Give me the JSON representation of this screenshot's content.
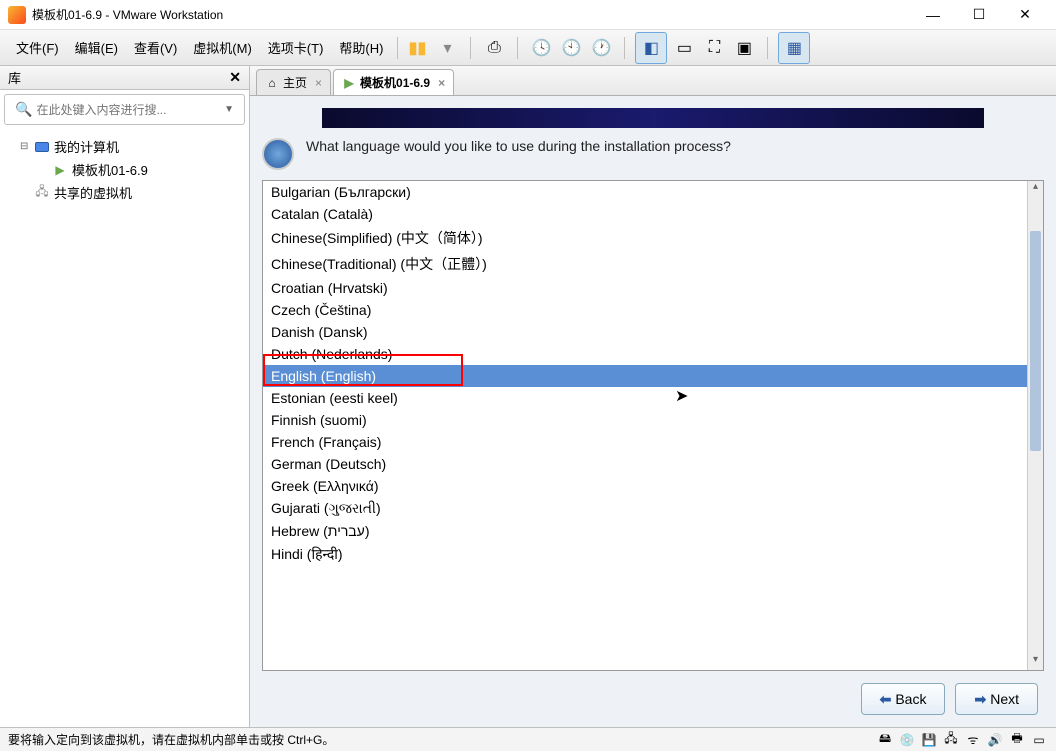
{
  "window": {
    "title": "模板机01-6.9 - VMware Workstation"
  },
  "menus": {
    "file": "文件(F)",
    "edit": "编辑(E)",
    "view": "查看(V)",
    "vm": "虚拟机(M)",
    "tabs": "选项卡(T)",
    "help": "帮助(H)"
  },
  "sidebar": {
    "title": "库",
    "search_placeholder": "在此处键入内容进行搜...",
    "tree": {
      "my_computer": "我的计算机",
      "vm1": "模板机01-6.9",
      "shared": "共享的虚拟机"
    }
  },
  "tabs": {
    "home": "主页",
    "vm": "模板机01-6.9"
  },
  "installer": {
    "prompt": "What language would you like to use during the installation process?",
    "languages": [
      "Bulgarian (Български)",
      "Catalan (Català)",
      "Chinese(Simplified) (中文（简体）)",
      "Chinese(Traditional) (中文（正體）)",
      "Croatian (Hrvatski)",
      "Czech (Čeština)",
      "Danish (Dansk)",
      "Dutch (Nederlands)",
      "English (English)",
      "Estonian (eesti keel)",
      "Finnish (suomi)",
      "French (Français)",
      "German (Deutsch)",
      "Greek (Ελληνικά)",
      "Gujarati (ગુજરાતી)",
      "Hebrew (עברית)",
      "Hindi (हिन्दी)"
    ],
    "selected_index": 8,
    "back": "Back",
    "next": "Next"
  },
  "statusbar": {
    "text": "要将输入定向到该虚拟机，请在虚拟机内部单击或按 Ctrl+G。"
  }
}
